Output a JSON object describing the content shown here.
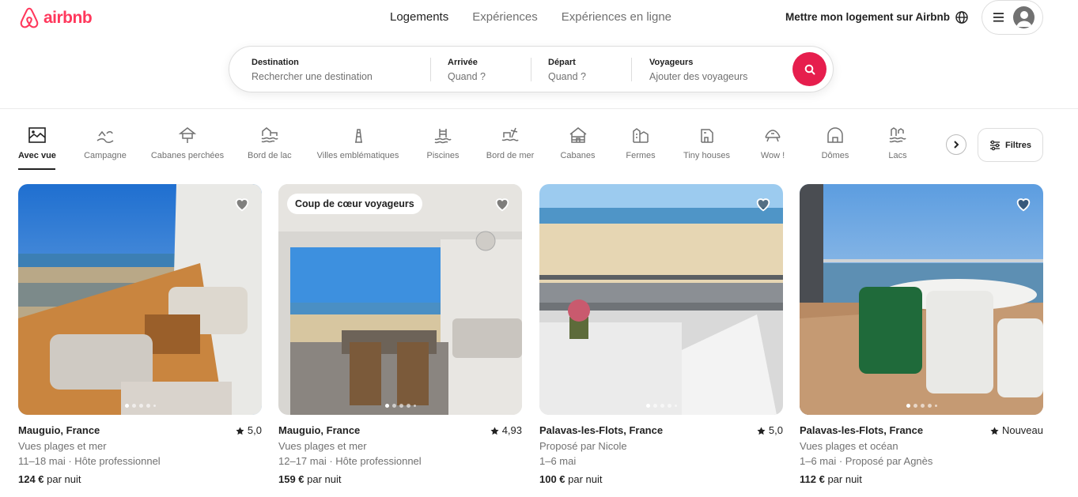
{
  "brand": {
    "name": "airbnb",
    "color": "#FF385C"
  },
  "nav": {
    "tabs": [
      "Logements",
      "Expériences",
      "Expériences en ligne"
    ],
    "active": "Logements"
  },
  "header": {
    "host_link": "Mettre mon logement sur Airbnb"
  },
  "search": {
    "destination": {
      "label": "Destination",
      "placeholder": "Rechercher une destination"
    },
    "checkin": {
      "label": "Arrivée",
      "placeholder": "Quand ?"
    },
    "checkout": {
      "label": "Départ",
      "placeholder": "Quand ?"
    },
    "guests": {
      "label": "Voyageurs",
      "placeholder": "Ajouter des voyageurs"
    },
    "button_color": "#E61E4D"
  },
  "categories": [
    {
      "label": "Avec vue",
      "icon": "view-icon",
      "active": true
    },
    {
      "label": "Campagne",
      "icon": "countryside-icon"
    },
    {
      "label": "Cabanes perchées",
      "icon": "treehouse-icon"
    },
    {
      "label": "Bord de lac",
      "icon": "lakefront-icon"
    },
    {
      "label": "Villes emblématiques",
      "icon": "iconic-city-icon"
    },
    {
      "label": "Piscines",
      "icon": "pool-icon"
    },
    {
      "label": "Bord de mer",
      "icon": "beachfront-icon"
    },
    {
      "label": "Cabanes",
      "icon": "cabin-icon"
    },
    {
      "label": "Fermes",
      "icon": "farm-icon"
    },
    {
      "label": "Tiny houses",
      "icon": "tiny-house-icon"
    },
    {
      "label": "Wow !",
      "icon": "wow-icon"
    },
    {
      "label": "Dômes",
      "icon": "dome-icon"
    },
    {
      "label": "Lacs",
      "icon": "lake-icon"
    }
  ],
  "filters_label": "Filtres",
  "listings": [
    {
      "location": "Mauguio, France",
      "rating": "5,0",
      "line1": "Vues plages et mer",
      "line2": "11–18 mai · Hôte professionnel",
      "price": "124 €",
      "price_suffix": " par nuit",
      "badge": ""
    },
    {
      "location": "Mauguio, France",
      "rating": "4,93",
      "line1": "Vues plages et mer",
      "line2": "12–17 mai · Hôte professionnel",
      "price": "159 €",
      "price_suffix": " par nuit",
      "badge": "Coup de cœur voyageurs"
    },
    {
      "location": "Palavas-les-Flots, France",
      "rating": "5,0",
      "line1": "Proposé par Nicole",
      "line2": "1–6 mai",
      "price": "100 €",
      "price_suffix": " par nuit",
      "badge": ""
    },
    {
      "location": "Palavas-les-Flots, France",
      "rating": "Nouveau",
      "line1": "Vues plages et océan",
      "line2": "1–6 mai · Proposé par Agnès",
      "price": "112 €",
      "price_suffix": " par nuit",
      "badge": ""
    }
  ]
}
